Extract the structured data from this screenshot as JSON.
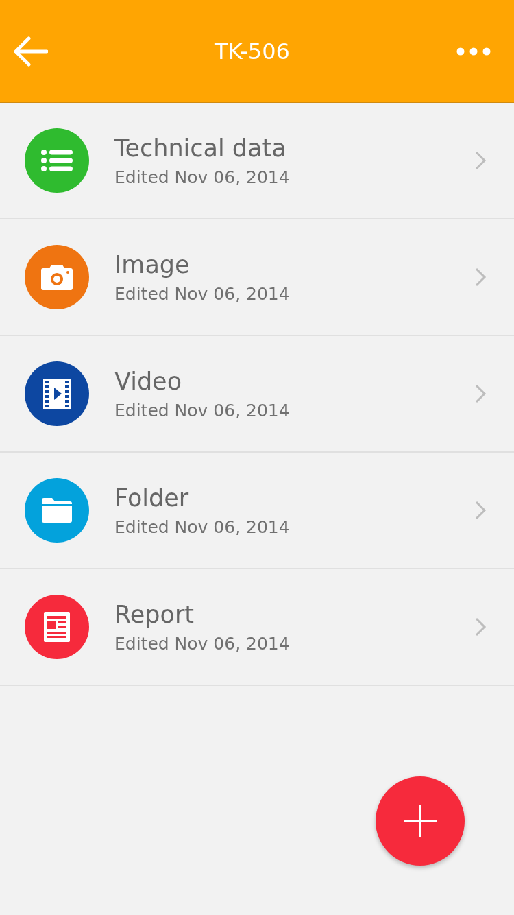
{
  "header": {
    "title": "TK-506"
  },
  "items": [
    {
      "kind": "list",
      "color": "#2fbb2f",
      "title": "Technical data",
      "subtitle": "Edited Nov 06, 2014"
    },
    {
      "kind": "camera",
      "color": "#ef7411",
      "title": "Image",
      "subtitle": "Edited Nov 06, 2014"
    },
    {
      "kind": "video",
      "color": "#0d47a1",
      "title": "Video",
      "subtitle": "Edited Nov 06, 2014"
    },
    {
      "kind": "folder",
      "color": "#03a2dc",
      "title": "Folder",
      "subtitle": "Edited Nov 06, 2014"
    },
    {
      "kind": "report",
      "color": "#f62a3c",
      "title": "Report",
      "subtitle": "Edited Nov 06, 2014"
    }
  ]
}
